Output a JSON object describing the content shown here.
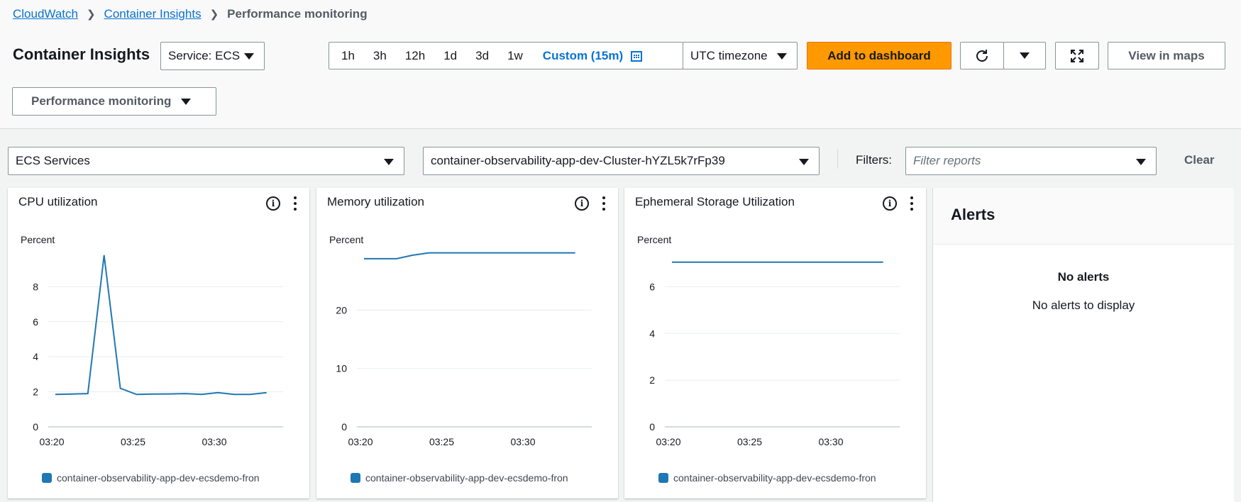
{
  "breadcrumb": [
    "CloudWatch",
    "Container Insights",
    "Performance monitoring"
  ],
  "page_title": "Container Insights",
  "service_select": "Service: ECS",
  "time_ranges": [
    "1h",
    "3h",
    "12h",
    "1d",
    "3d",
    "1w"
  ],
  "custom_range": "Custom (15m)",
  "timezone": "UTC timezone",
  "add_dashboard": "Add to dashboard",
  "view_in_maps": "View in maps",
  "view_select": "Performance monitoring",
  "resource_type": "ECS Services",
  "cluster": "container-observability-app-dev-Cluster-hYZL5k7rFp39",
  "filters_label": "Filters:",
  "filter_placeholder": "Filter reports",
  "clear": "Clear",
  "icons": [
    "calendar-icon",
    "refresh-icon",
    "expand-icon",
    "info-icon",
    "more-icon"
  ],
  "colors": {
    "accent": "#0972d3",
    "primary_button": "#ff9900",
    "series": "#1f77b4"
  },
  "charts": [
    {
      "title": "CPU utilization",
      "unit": "Percent",
      "legend": "container-observability-app-dev-ecsdemo-fron",
      "yticks": [
        "0",
        "2",
        "4",
        "6",
        "8"
      ],
      "xticks": [
        "03:20",
        "03:25",
        "03:30"
      ]
    },
    {
      "title": "Memory utilization",
      "unit": "Percent",
      "legend": "container-observability-app-dev-ecsdemo-fron",
      "yticks": [
        "0",
        "10",
        "20"
      ],
      "xticks": [
        "03:20",
        "03:25",
        "03:30"
      ]
    },
    {
      "title": "Ephemeral Storage Utilization",
      "unit": "Percent",
      "legend": "container-observability-app-dev-ecsdemo-fron",
      "yticks": [
        "0",
        "2",
        "4",
        "6"
      ],
      "xticks": [
        "03:20",
        "03:25",
        "03:30"
      ]
    }
  ],
  "chart_data": [
    {
      "type": "line",
      "title": "CPU utilization",
      "ylabel": "Percent",
      "x": [
        "03:20",
        "03:21",
        "03:22",
        "03:23",
        "03:24",
        "03:25",
        "03:26",
        "03:27",
        "03:28",
        "03:29",
        "03:30",
        "03:31",
        "03:32",
        "03:33"
      ],
      "ylim": [
        0,
        10
      ],
      "series": [
        {
          "name": "container-observability-app-dev-ecsdemo-fron",
          "values": [
            1.85,
            1.87,
            1.9,
            9.8,
            2.2,
            1.85,
            1.87,
            1.88,
            1.9,
            1.85,
            1.95,
            1.85,
            1.85,
            1.95
          ]
        }
      ]
    },
    {
      "type": "line",
      "title": "Memory utilization",
      "ylabel": "Percent",
      "x": [
        "03:20",
        "03:21",
        "03:22",
        "03:23",
        "03:24",
        "03:25",
        "03:26",
        "03:27",
        "03:28",
        "03:29",
        "03:30",
        "03:31",
        "03:32",
        "03:33"
      ],
      "ylim": [
        0,
        30
      ],
      "series": [
        {
          "name": "container-observability-app-dev-ecsdemo-fron",
          "values": [
            28.8,
            28.8,
            28.8,
            29.4,
            29.8,
            29.8,
            29.8,
            29.8,
            29.8,
            29.8,
            29.8,
            29.8,
            29.8,
            29.8
          ]
        }
      ]
    },
    {
      "type": "line",
      "title": "Ephemeral Storage Utilization",
      "ylabel": "Percent",
      "x": [
        "03:20",
        "03:21",
        "03:22",
        "03:23",
        "03:24",
        "03:25",
        "03:26",
        "03:27",
        "03:28",
        "03:29",
        "03:30",
        "03:31",
        "03:32",
        "03:33"
      ],
      "ylim": [
        0,
        7.5
      ],
      "series": [
        {
          "name": "container-observability-app-dev-ecsdemo-fron",
          "values": [
            7.05,
            7.05,
            7.05,
            7.05,
            7.05,
            7.05,
            7.05,
            7.05,
            7.05,
            7.05,
            7.05,
            7.05,
            7.05,
            7.05
          ]
        }
      ]
    }
  ],
  "alerts": {
    "title": "Alerts",
    "empty_title": "No alerts",
    "empty_text": "No alerts to display"
  }
}
